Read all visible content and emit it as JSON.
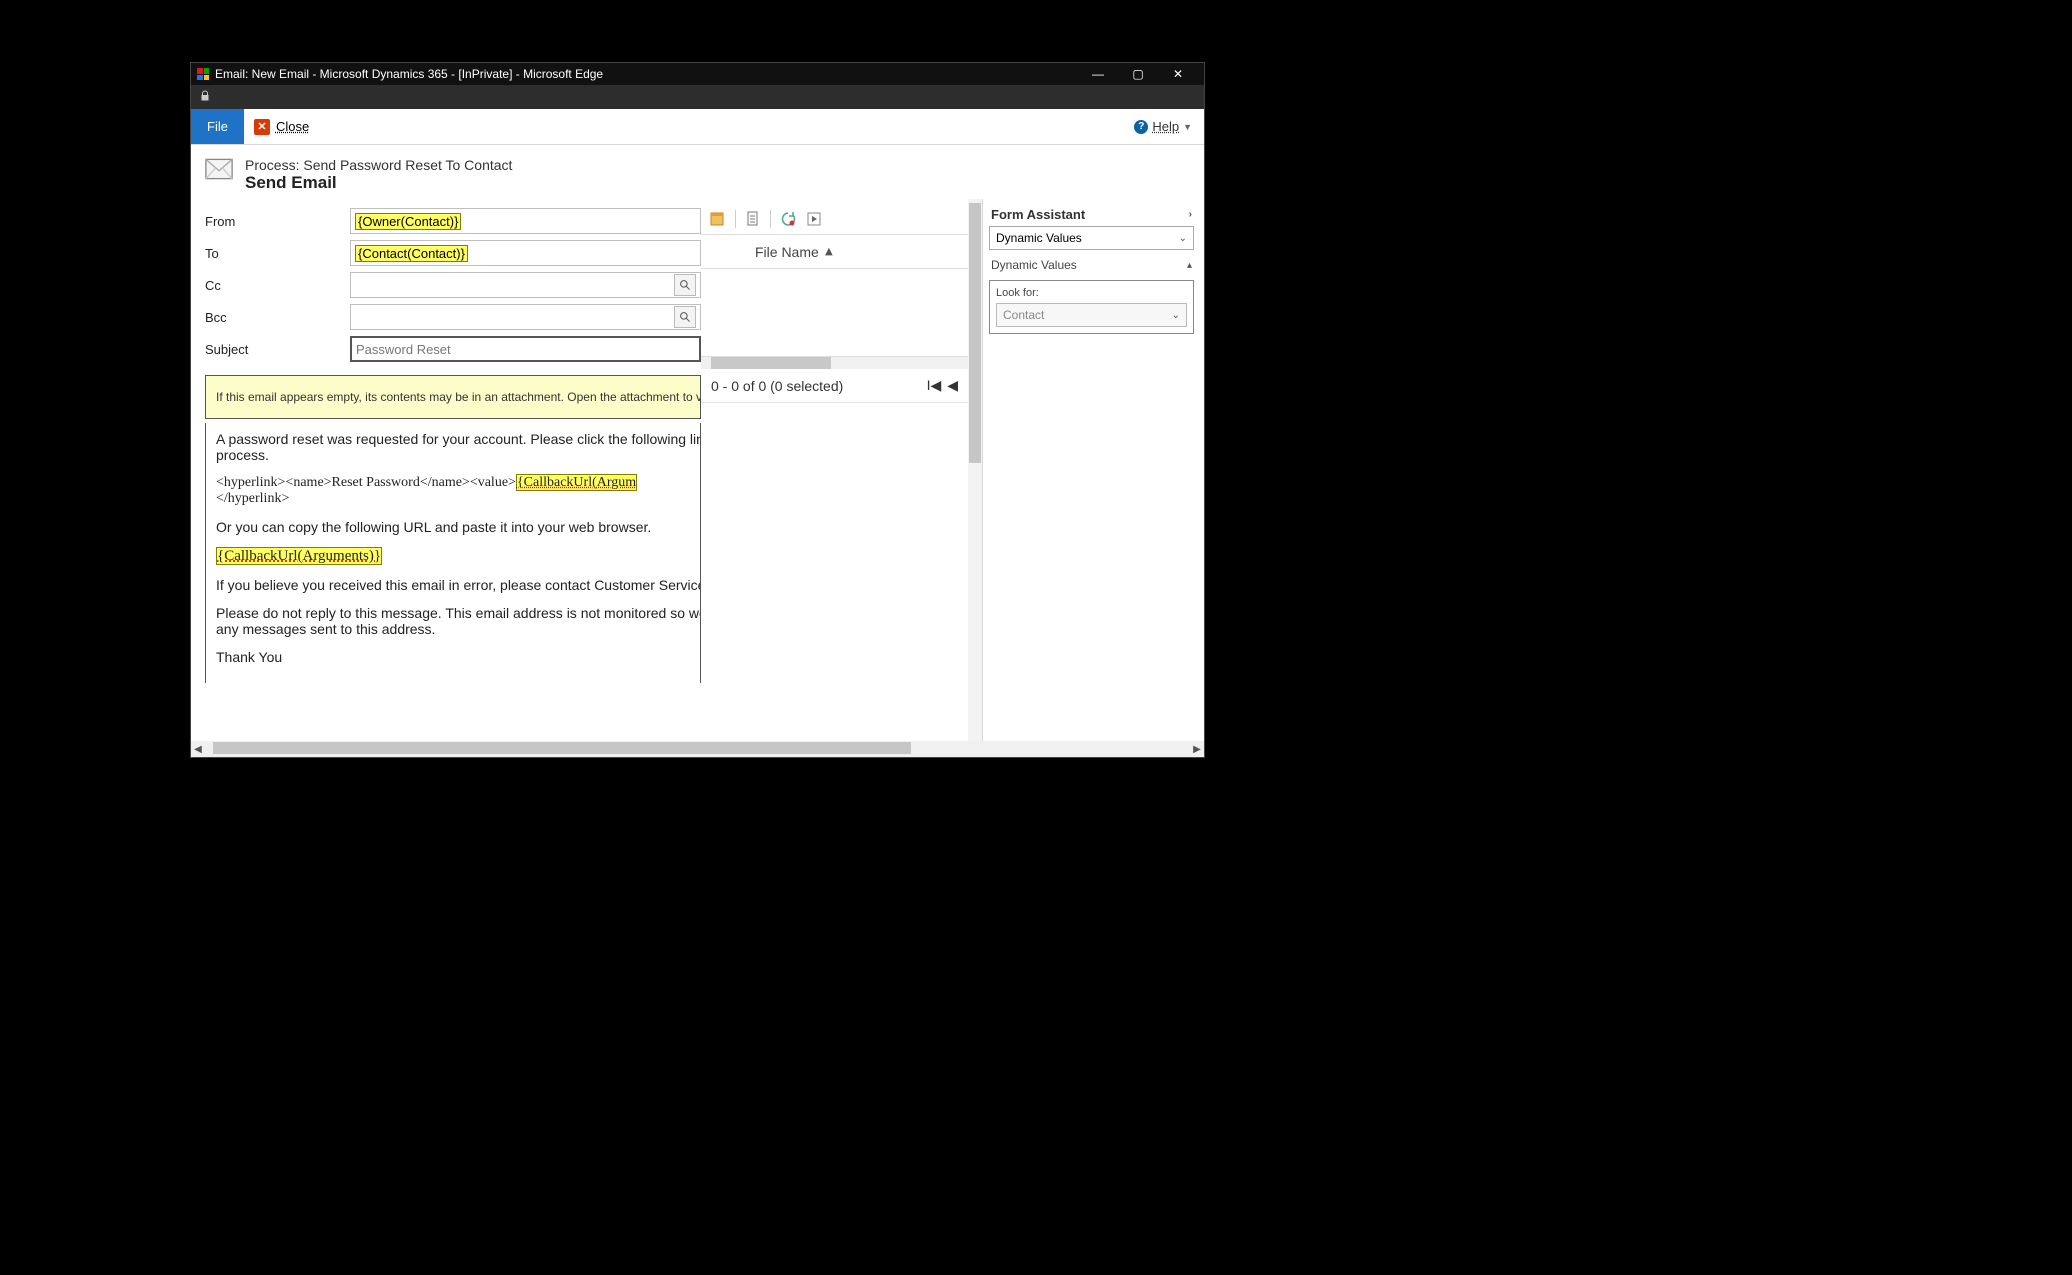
{
  "window": {
    "title": "Email: New Email - Microsoft Dynamics 365 - [InPrivate] - Microsoft Edge"
  },
  "toolbar": {
    "file": "File",
    "close": "Close",
    "help": "Help"
  },
  "header": {
    "process": "Process: Send Password Reset To Contact",
    "action": "Send Email"
  },
  "fields": {
    "from_label": "From",
    "from_value": "{Owner(Contact)}",
    "to_label": "To",
    "to_value": "{Contact(Contact)}",
    "cc_label": "Cc",
    "bcc_label": "Bcc",
    "subject_label": "Subject",
    "subject_value": "Password Reset"
  },
  "notice": "If this email appears empty, its contents may be in an attachment. Open the attachment to view the",
  "body": {
    "p1": "A password reset was requested for your account. Please click the following link to",
    "p1b": "process.",
    "h_pre": "<hyperlink><name>Reset Password</name><value>",
    "h_slug": "{CallbackUrl(Argum",
    "h_close": "</hyperlink>",
    "p2": "Or you can copy the following URL and paste it into your web browser.",
    "slug2": "{CallbackUrl(Arguments)}",
    "p3": "If you believe you received this email in error, please contact Customer Service for",
    "p4a": "Please do not reply to this message. This email address is not monitored so we are",
    "p4b": "any messages sent to this address.",
    "p5": "Thank You"
  },
  "files": {
    "header": "File Name",
    "status": "0 - 0 of 0 (0 selected)"
  },
  "assistant": {
    "title": "Form Assistant",
    "dropdown": "Dynamic Values",
    "sub": "Dynamic Values",
    "lookfor_label": "Look for:",
    "lookfor_value": "Contact"
  }
}
